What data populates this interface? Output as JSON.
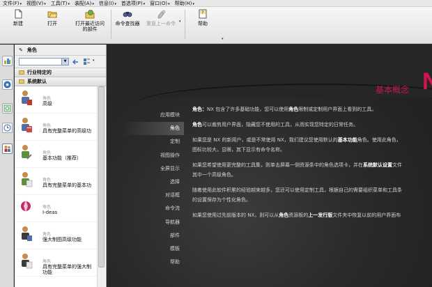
{
  "menubar": {
    "items": [
      "文件(F)",
      "视图(V)",
      "工具(T)",
      "装配(A)",
      "信息(I)",
      "首选项(P)",
      "窗口(O)",
      "帮助(H)"
    ]
  },
  "toolbar": {
    "new": "新建",
    "open": "打开",
    "recent": [
      "打开最近访问",
      "的部件"
    ],
    "command_finder": "命令查找器",
    "repeat_last": "重复上一命令",
    "help": "帮助"
  },
  "panel": {
    "title": "角色",
    "groups": [
      "行业特定的",
      "系统默认"
    ],
    "role_category": "角色",
    "roles": [
      {
        "name": "高级",
        "line2": ""
      },
      {
        "name": "具有完整菜单的高级功",
        "line2": ""
      },
      {
        "name": "基本功能（推荐）",
        "line2": ""
      },
      {
        "name": "具有完整菜单的基本功",
        "line2": ""
      },
      {
        "name": "I-deas",
        "line2": ""
      },
      {
        "name": "强大制图高级功能",
        "line2": ""
      },
      {
        "name": "具有完整菜单的强大制",
        "line2": "功能"
      }
    ]
  },
  "content": {
    "heading": "基本概念",
    "heading_cut": "N",
    "nav": [
      "应用模块",
      "角色",
      "定制",
      "视图操作",
      "全屏显示",
      "选择",
      "对话框",
      "命令流",
      "导航器",
      "部件",
      "模板",
      "帮助"
    ],
    "active_nav": "角色",
    "paragraphs": [
      {
        "bold_a": "角色：",
        "t1": "NX 包含了许多基础功能，您可以使用",
        "bold_b": "角色",
        "t2": "限制或定制用户界面上看到的工具。"
      },
      {
        "bold_a": "角色",
        "t1": "可以裁剪用户界面，隐藏您不使用的工具，从而实现您特定的日常任务。",
        "bold_b": "",
        "t2": ""
      },
      {
        "bold_a": "",
        "t1": "如果您是 NX 的新用户，或是不常使用 NX，我们建议您使用默认的",
        "bold_b": "基本功能",
        "t2": "角色。使用此角色，",
        "t3": "图标比较大，显眼，其下显示有命令名称。"
      },
      {
        "bold_a": "",
        "t1": "如果您希望使用更完整的工具集，则单击屏幕一侧资源条中的角色选项卡，并在",
        "bold_b": "系统默认设置",
        "t2": "文件",
        "t3": "其中一个高级角色。"
      },
      {
        "bold_a": "",
        "t1": "随着使用此软件积累的经验越来越多，您还可以使用定制工具，根据自己的需要组织菜单和工具条",
        "bold_b": "",
        "t2": "",
        "t3": "的设置保存为个性化角色。"
      },
      {
        "bold_a": "",
        "t1": "如果您使用过先前版本的 NX，则可以从",
        "bold_b": "角色",
        "t2": "资源板的",
        "bold_c": "上一发行版",
        "t3": "文件夹中恢复以前的用户界面布"
      }
    ]
  },
  "colors": {
    "accent": "#d21450",
    "background": "#2a2a2a"
  }
}
